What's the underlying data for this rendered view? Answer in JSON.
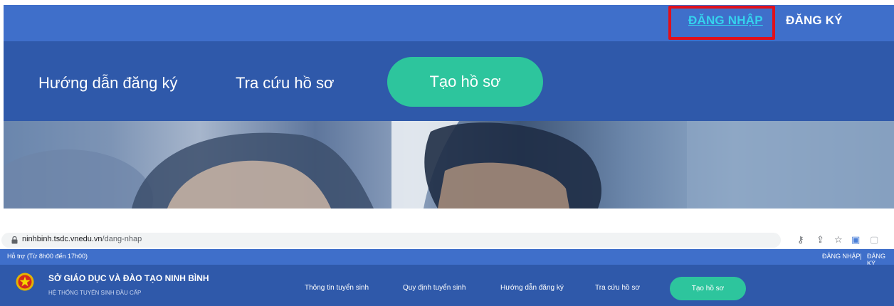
{
  "zoomed": {
    "auth": {
      "login": "ĐĂNG NHẬP",
      "register": "ĐĂNG KÝ"
    },
    "nav": {
      "guide": "Hướng dẫn đăng ký",
      "lookup": "Tra cứu hồ sơ",
      "create": "Tạo hồ sơ"
    }
  },
  "browser": {
    "url_host": "ninhbinh.tsdc.vnedu.vn",
    "url_path": "/dang-nhap"
  },
  "site": {
    "support": "Hỗ trợ (Từ 8h00 đến 17h00)",
    "auth": {
      "login": "ĐĂNG NHẬP",
      "separator": "|",
      "register": "ĐĂNG KÝ"
    },
    "org_name": "SỞ GIÁO DỤC VÀ ĐÀO TẠO NINH BÌNH",
    "org_sub": "HỆ THỐNG TUYỂN SINH ĐẦU CẤP",
    "nav": {
      "info": "Thông tin tuyển sinh",
      "rules": "Quy định tuyển sinh",
      "guide": "Hướng dẫn đăng ký",
      "lookup": "Tra cứu hồ sơ",
      "create": "Tạo hồ sơ"
    }
  },
  "colors": {
    "top_bar": "#3f6fca",
    "nav_bar": "#2f59aa",
    "cta": "#2dc59d",
    "highlight": "#e0101b",
    "active_link": "#34d3ee"
  }
}
